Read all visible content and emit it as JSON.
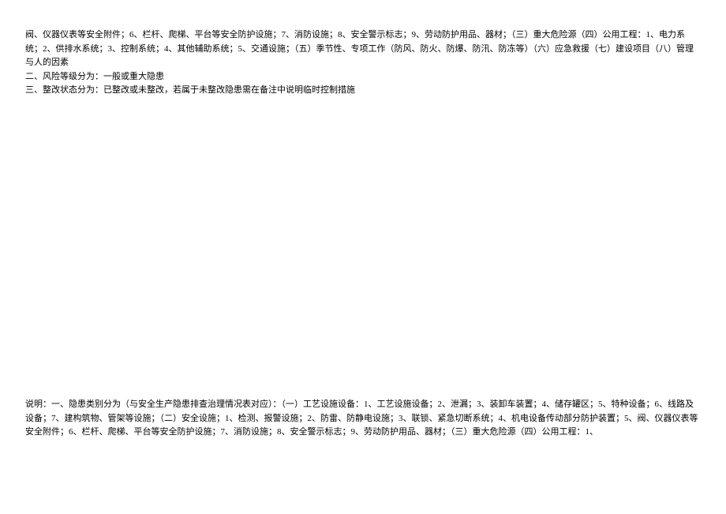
{
  "topSection": {
    "line1": "阀、仪器仪表等安全附件；6、栏杆、爬梯、平台等安全防护设施；7、消防设施；8、安全警示标志；9、劳动防护用品、器材；（三）重大危险源（四）公用工程：1、电力系统；2、供排水系统；3、控制系统；4、其他辅助系统；5、交通设施；（五）季节性、专项工作（防风、防火、防爆、防汛、防冻等）（六）应急救援（七）建设项目（八）管理与人的因素",
    "line2": "二、风险等级分为：一般或重大隐患",
    "line3": "三、整改状态分为：已整改或未整改，若属于未整改隐患需在备注中说明临时控制措施"
  },
  "bottomSection": {
    "line1": "说明：一、隐患类别分为（与安全生产隐患排查治理情况表对应）：（一）工艺设施设备：1、工艺设施设备；2、泄漏；3、装卸车装置；4、储存罐区；5、特种设备；6、线路及设备；7、建构筑物、管架等设施；（二）安全设施；1、检测、报警设施；2、防雷、防静电设施；3、联锁、紧急切断系统；4、机电设备传动部分防护装置；5、阀、仪器仪表等安全附件；6、栏杆、爬梯、平台等安全防护设施；7、消防设施；8、安全警示标志；9、劳动防护用品、器材；（三）重大危险源（四）公用工程：1、"
  }
}
